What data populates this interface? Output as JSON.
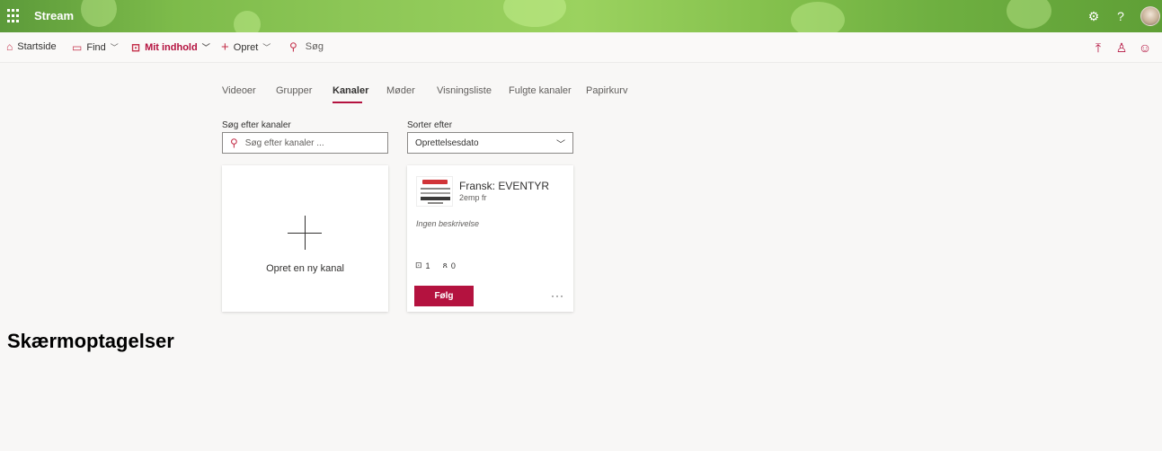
{
  "topbar": {
    "app_title": "Stream",
    "icons": [
      "waffle-icon",
      "settings-icon",
      "help-icon",
      "avatar"
    ]
  },
  "cmdbar": {
    "home": "Startside",
    "find": "Find",
    "my_content": "Mit indhold",
    "create": "Opret",
    "search": "Søg"
  },
  "tabs": [
    {
      "label": "Videoer",
      "active": false
    },
    {
      "label": "Grupper",
      "active": false
    },
    {
      "label": "Kanaler",
      "active": true
    },
    {
      "label": "Møder",
      "active": false
    },
    {
      "label": "Visningsliste",
      "active": false
    },
    {
      "label": "Fulgte kanaler",
      "active": false
    },
    {
      "label": "Papirkurv",
      "active": false
    }
  ],
  "search": {
    "label": "Søg efter kanaler",
    "placeholder": "Søg efter kanaler ...",
    "value": ""
  },
  "sort": {
    "label": "Sorter efter",
    "selected": "Oprettelsesdato"
  },
  "new_channel": {
    "label": "Opret en ny kanal"
  },
  "channel": {
    "title": "Fransk: EVENTYR",
    "owner": "2emp fr",
    "description": "Ingen beskrivelse",
    "video_count": "1",
    "follower_count": "0",
    "follow_label": "Følg",
    "more_label": "···"
  },
  "section_heading": "Skærmoptagelser",
  "colors": {
    "accent": "#b4123f",
    "banner_green": "#8cc656",
    "background": "#f8f7f6"
  }
}
